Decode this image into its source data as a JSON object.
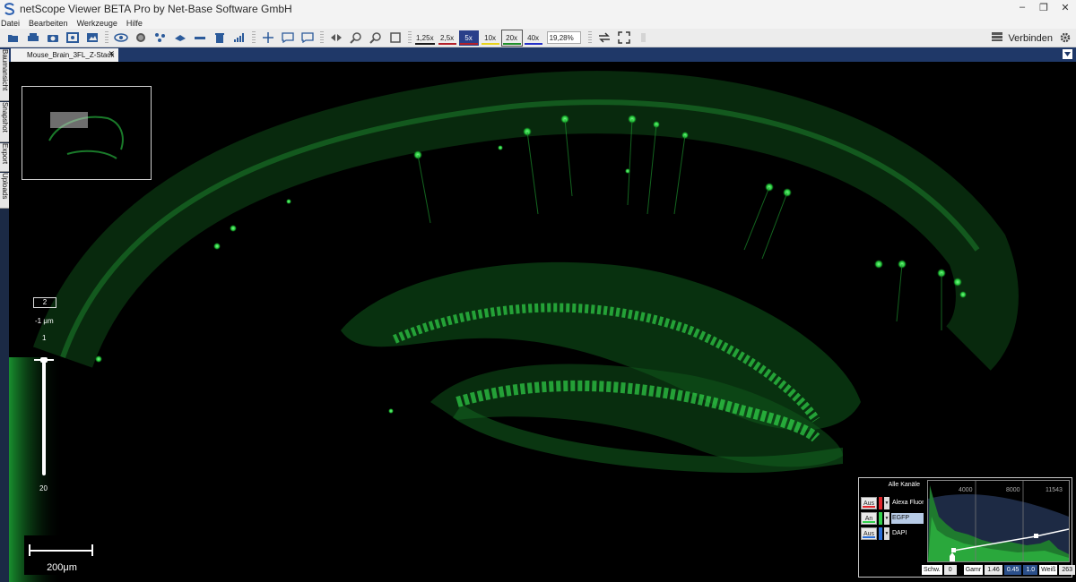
{
  "app": {
    "title": "netScope Viewer BETA Pro by Net-Base Software GmbH"
  },
  "menu": [
    "Datei",
    "Bearbeiten",
    "Werkzeuge",
    "Hilfe"
  ],
  "toolbar": {
    "zoom_levels": [
      {
        "label": "1,25x",
        "color": "#1a1a1a",
        "active": false,
        "boxed": false
      },
      {
        "label": "2,5x",
        "color": "#b3202a",
        "active": false,
        "boxed": false
      },
      {
        "label": "5x",
        "color": "#b3202a",
        "active": true,
        "boxed": false
      },
      {
        "label": "10x",
        "color": "#e8d31a",
        "active": false,
        "boxed": false
      },
      {
        "label": "20x",
        "color": "#1f8f2a",
        "active": false,
        "boxed": true
      },
      {
        "label": "40x",
        "color": "#2430c9",
        "active": false,
        "boxed": false
      }
    ],
    "zoom_percent": "19,28%",
    "connect_label": "Verbinden"
  },
  "tab": {
    "title": "Mouse_Brain_3FL_Z-Stack"
  },
  "side_tabs": [
    "Baumansicht",
    "Snapshot",
    "Export",
    "Uploads"
  ],
  "z_slider": {
    "current": "2",
    "unit": "-1 μm",
    "min": "1",
    "max": "20",
    "value": 2
  },
  "scale_bar": {
    "label": "200μm"
  },
  "channels": {
    "header": "Alle Kanäle",
    "items": [
      {
        "toggle": "Aus",
        "name": "Alexa Fluor 5",
        "color": "#e0262c",
        "selected": false
      },
      {
        "toggle": "An",
        "name": "EGFP",
        "color": "#2fd04a",
        "selected": true
      },
      {
        "toggle": "Aus",
        "name": "DAPI",
        "color": "#2a6fd8",
        "selected": false
      }
    ]
  },
  "histogram": {
    "ticks": [
      "4000",
      "8000",
      "11543"
    ],
    "black_label": "Schw.",
    "black_value": "0",
    "gamma_label": "Gamr",
    "gamma_value": "1.46",
    "mid_value_1": "0.45",
    "mid_value_2": "1.0",
    "white_label": "Weiß",
    "white_value": "263"
  }
}
